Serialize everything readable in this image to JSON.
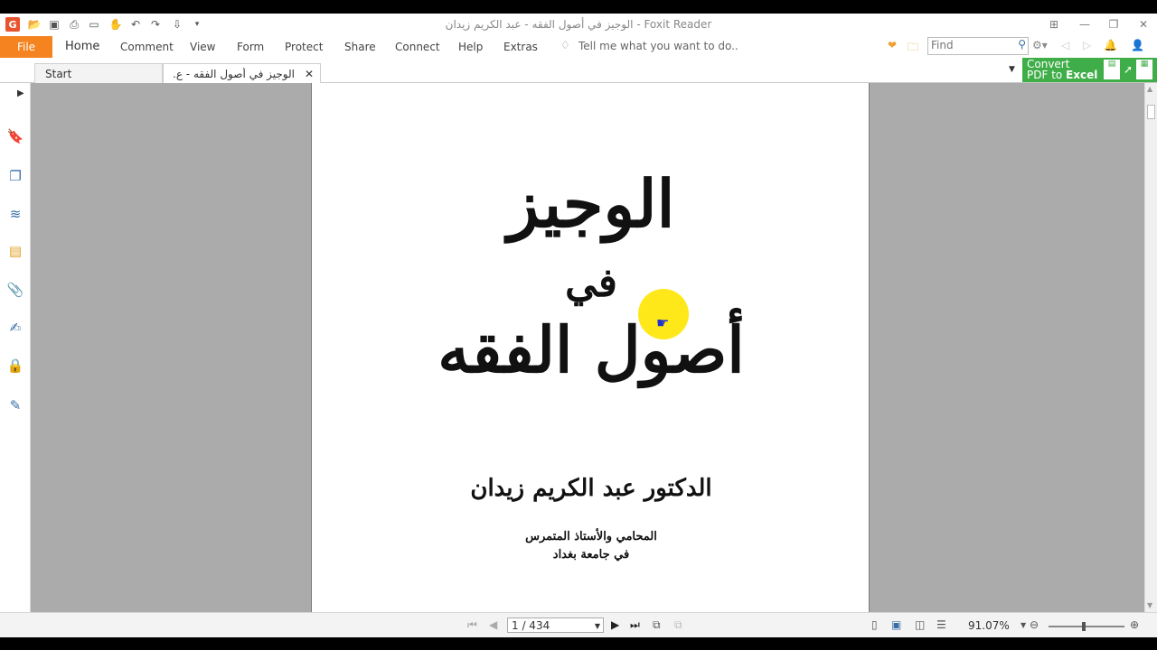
{
  "window": {
    "title": "الوجيز في أصول الفقه - عبد الكريم زيدان - Foxit Reader"
  },
  "menu": {
    "file": "File",
    "items": [
      "Home",
      "Comment",
      "View",
      "Form",
      "Protect",
      "Share",
      "Connect",
      "Help",
      "Extras"
    ],
    "tell_me": "Tell me what you want to do.."
  },
  "find": {
    "placeholder": "Find"
  },
  "tabs": {
    "start": "Start",
    "document": "الوجيز في أصول الفقه - ع..."
  },
  "convert": {
    "line1": "Convert",
    "line2_prefix": "PDF to ",
    "line2_bold": "Excel"
  },
  "page_content": {
    "title_line1": "الوجيز",
    "title_line2": "في",
    "title_line3": "أصول الفقه",
    "author": "الدكتور عبد الكريم زيدان",
    "role_line1": "المحامي والأستاذ المتمرس",
    "role_line2": "في جامعة بغداد"
  },
  "status": {
    "page_indicator": "1 / 434",
    "zoom": "91.07%"
  },
  "colors": {
    "file_menu": "#f5831f",
    "convert_banner": "#3fae49",
    "doc_background": "#ababab",
    "cursor_highlight": "#ffe81a"
  },
  "icons": {
    "sidebar": [
      "bookmark-icon",
      "pages-icon",
      "layers-icon",
      "comments-icon",
      "attachments-icon",
      "signatures-icon",
      "security-icon",
      "tools-icon"
    ]
  }
}
